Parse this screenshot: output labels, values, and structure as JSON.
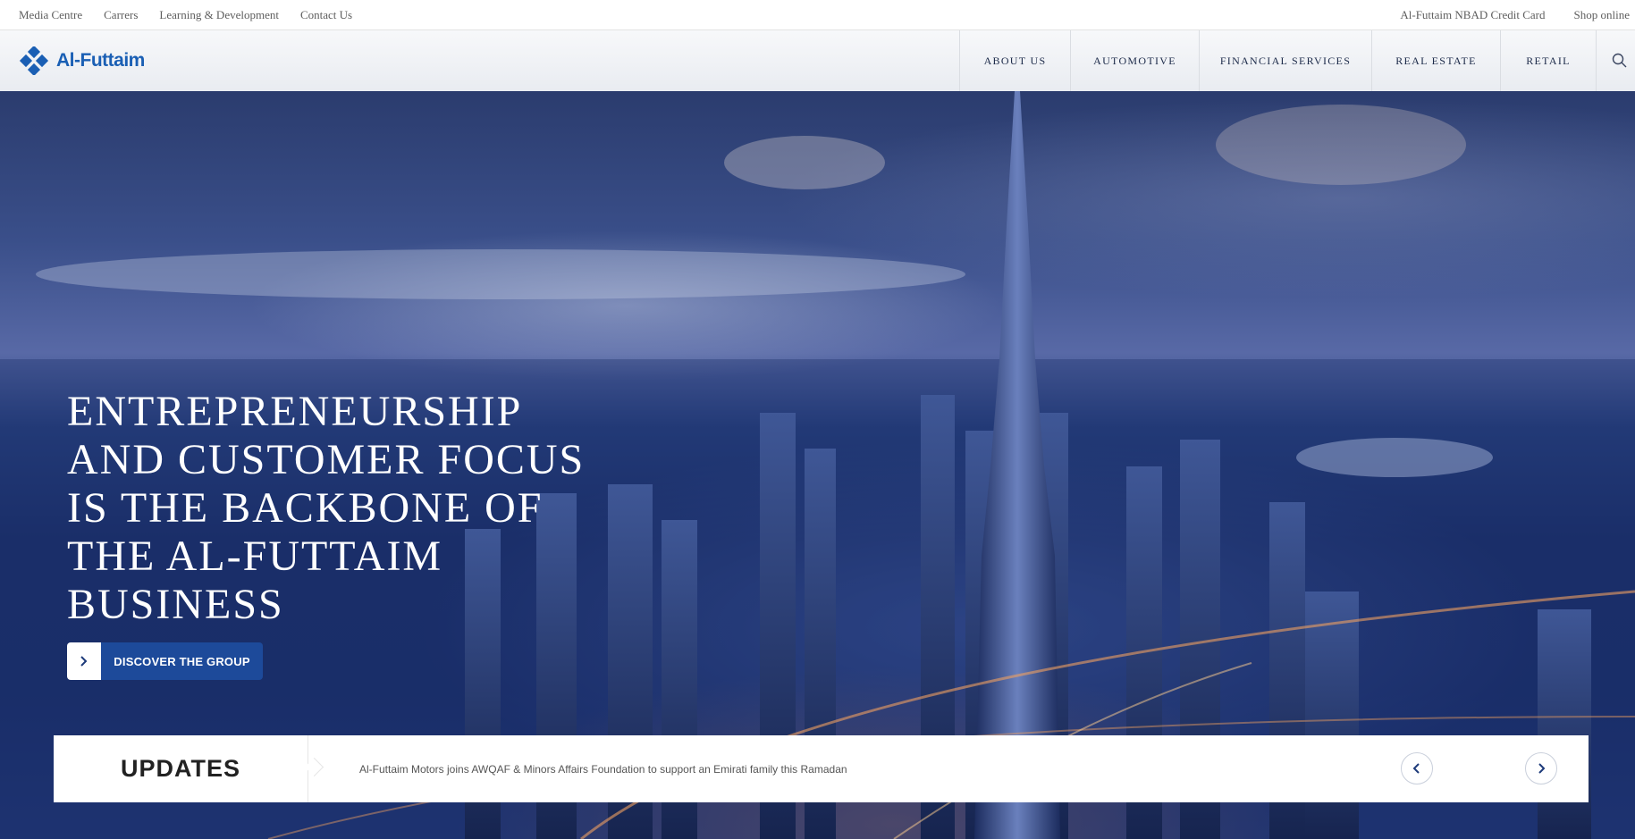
{
  "utility_nav": {
    "left_links": [
      "Media Centre",
      "Carrers",
      "Learning & Development",
      "Contact Us"
    ],
    "right_links": [
      "Al-Futtaim NBAD Credit Card",
      "Shop online"
    ]
  },
  "brand": {
    "logo_text": "Al-Futtaim",
    "logo_icon": "diamond-logo-icon",
    "color": "#1a5fb4"
  },
  "main_nav": {
    "items": [
      "ABOUT US",
      "AUTOMOTIVE",
      "FINANCIAL SERVICES",
      "REAL ESTATE",
      "RETAIL"
    ],
    "search_icon": "search-icon"
  },
  "hero": {
    "headline_lines": [
      "ENTREPRENEURSHIP",
      "AND CUSTOMER FOCUS",
      "IS THE BACKBONE OF",
      "THE AL-FUTTAIM",
      "BUSINESS"
    ],
    "cta_label": "DISCOVER THE GROUP",
    "cta_icon": "chevron-right-icon",
    "cta_color": "#1d4a9a"
  },
  "updates": {
    "title": "UPDATES",
    "headline": "Al-Futtaim Motors joins AWQAF & Minors Affairs Foundation to support an Emirati family this Ramadan",
    "prev_icon": "chevron-left-icon",
    "next_icon": "chevron-right-icon"
  }
}
